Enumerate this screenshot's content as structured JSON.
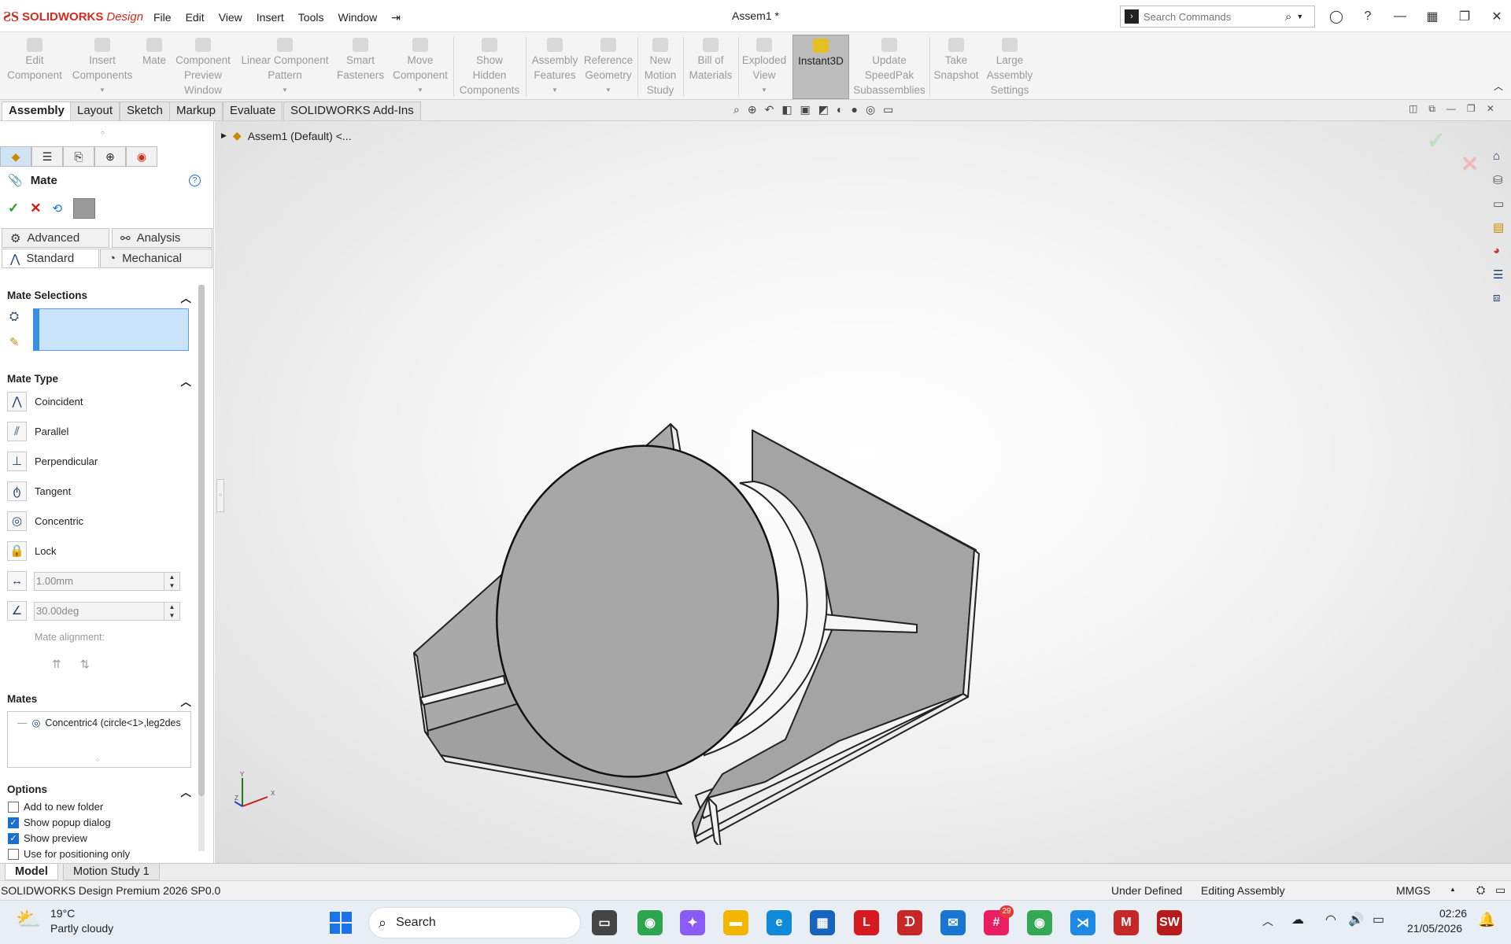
{
  "titlebar": {
    "brand": "SOLIDWORKS",
    "brand_suffix": "Design",
    "menus": [
      "File",
      "Edit",
      "View",
      "Insert",
      "Tools",
      "Window"
    ],
    "document_title": "Assem1 *",
    "search_placeholder": "Search Commands"
  },
  "ribbon": {
    "buttons": [
      {
        "label1": "Edit",
        "label2": "Component",
        "label3": ""
      },
      {
        "label1": "Insert",
        "label2": "Components",
        "label3": ""
      },
      {
        "label1": "Mate",
        "label2": "",
        "label3": ""
      },
      {
        "label1": "Component",
        "label2": "Preview",
        "label3": "Window"
      },
      {
        "label1": "Linear Component",
        "label2": "Pattern",
        "label3": ""
      },
      {
        "label1": "Smart",
        "label2": "Fasteners",
        "label3": ""
      },
      {
        "label1": "Move",
        "label2": "Component",
        "label3": ""
      },
      {
        "label1": "Show",
        "label2": "Hidden",
        "label3": "Components"
      },
      {
        "label1": "Assembly",
        "label2": "Features",
        "label3": ""
      },
      {
        "label1": "Reference",
        "label2": "Geometry",
        "label3": ""
      },
      {
        "label1": "New",
        "label2": "Motion",
        "label3": "Study"
      },
      {
        "label1": "Bill of",
        "label2": "Materials",
        "label3": ""
      },
      {
        "label1": "Exploded",
        "label2": "View",
        "label3": ""
      },
      {
        "label1": "Instant3D",
        "label2": "",
        "label3": ""
      },
      {
        "label1": "Update",
        "label2": "SpeedPak",
        "label3": "Subassemblies"
      },
      {
        "label1": "Take",
        "label2": "Snapshot",
        "label3": ""
      },
      {
        "label1": "Large",
        "label2": "Assembly",
        "label3": "Settings"
      }
    ]
  },
  "tabs": [
    "Assembly",
    "Layout",
    "Sketch",
    "Markup",
    "Evaluate",
    "SOLIDWORKS Add-Ins"
  ],
  "tree": {
    "root": "Assem1 (Default) <..."
  },
  "mate_panel": {
    "title": "Mate",
    "subtabs": {
      "advanced": "Advanced",
      "analysis": "Analysis",
      "standard": "Standard",
      "mechanical": "Mechanical"
    },
    "mate_selections": "Mate Selections",
    "mate_type": "Mate Type",
    "types": [
      "Coincident",
      "Parallel",
      "Perpendicular",
      "Tangent",
      "Concentric",
      "Lock"
    ],
    "distance_value": "1.00mm",
    "angle_value": "30.00deg",
    "mate_alignment": "Mate alignment:",
    "mates_head": "Mates",
    "mates_item": "Concentric4 (circle<1>,leg2des",
    "options_head": "Options",
    "options": [
      {
        "label": "Add to new folder",
        "checked": false
      },
      {
        "label": "Show popup dialog",
        "checked": true
      },
      {
        "label": "Show preview",
        "checked": true
      },
      {
        "label": "Use for positioning only",
        "checked": false
      }
    ]
  },
  "bottom_tabs": [
    "Model",
    "Motion Study 1"
  ],
  "status": {
    "left": "SOLIDWORKS Design Premium 2026 SP0.0",
    "defined": "Under Defined",
    "mode": "Editing Assembly",
    "units": "MMGS"
  },
  "taskbar": {
    "weather_temp": "19°C",
    "weather_desc": "Partly cloudy",
    "search": "Search",
    "time": "02:26",
    "date": "21/05/2026",
    "badge": "29"
  },
  "colors": {
    "accent": "#1a6fd0",
    "brand": "#d52b1e",
    "part": "#a9a9a9"
  }
}
